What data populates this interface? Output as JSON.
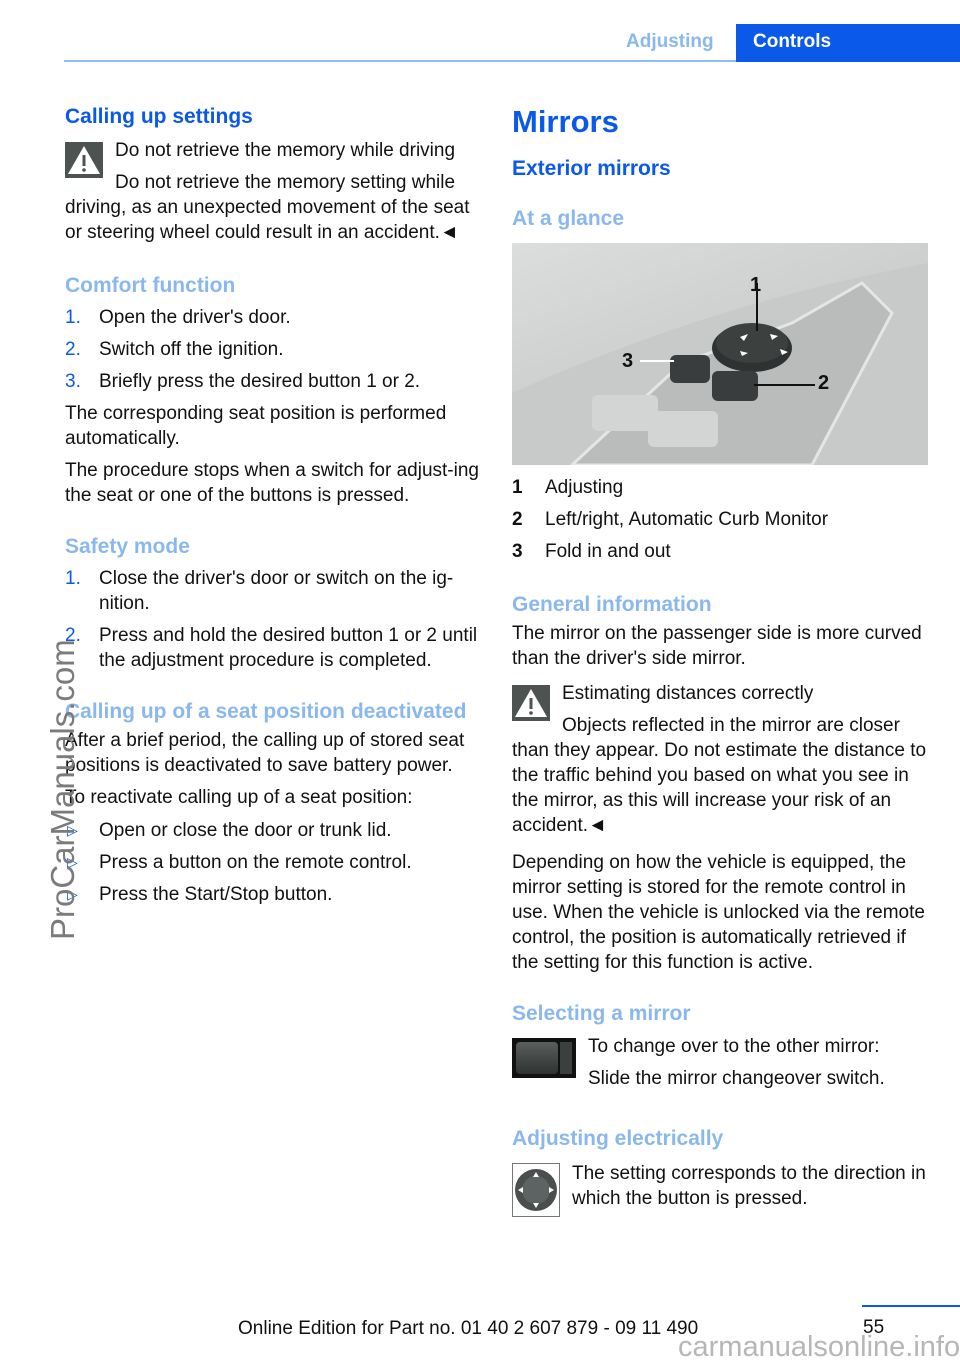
{
  "header": {
    "section": "Adjusting",
    "chapter": "Controls"
  },
  "left": {
    "calling_up_settings": {
      "title": "Calling up settings",
      "warning_title": "Do not retrieve the memory while driving",
      "warning_text": "Do not retrieve the memory setting while driving, as an unexpected movement of the seat or steering wheel could result in an accident.◄"
    },
    "comfort_function": {
      "title": "Comfort function",
      "steps": [
        {
          "num": "1.",
          "text": "Open the driver's door."
        },
        {
          "num": "2.",
          "text": "Switch off the ignition."
        },
        {
          "num": "3.",
          "text": "Briefly press the desired button 1 or 2."
        }
      ],
      "para1": "The corresponding seat position is performed automatically.",
      "para2": "The procedure stops when a switch for adjust-ing the seat or one of the buttons is pressed."
    },
    "safety_mode": {
      "title": "Safety mode",
      "steps": [
        {
          "num": "1.",
          "text": "Close the driver's door or switch on the ig-nition."
        },
        {
          "num": "2.",
          "text": "Press and hold the desired button 1 or 2 until the adjustment procedure is completed."
        }
      ]
    },
    "deactivated": {
      "title": "Calling up of a seat position deactivated",
      "para1": "After a brief period, the calling up of stored seat positions is deactivated to save battery power.",
      "para2": "To reactivate calling up of a seat position:",
      "bullets": [
        {
          "marker": "▷",
          "text": "Open or close the door or trunk lid."
        },
        {
          "marker": "▷",
          "text": "Press a button on the remote control."
        },
        {
          "marker": "▷",
          "text": "Press the Start/Stop button."
        }
      ]
    }
  },
  "right": {
    "title": "Mirrors",
    "subtitle": "Exterior mirrors",
    "at_a_glance": "At a glance",
    "figure_callouts": [
      "1",
      "2",
      "3"
    ],
    "legend": [
      {
        "num": "1",
        "text": "Adjusting"
      },
      {
        "num": "2",
        "text": "Left/right, Automatic Curb Monitor"
      },
      {
        "num": "3",
        "text": "Fold in and out"
      }
    ],
    "general": {
      "title": "General information",
      "para": "The mirror on the passenger side is more curved than the driver's side mirror.",
      "warning_title": "Estimating distances correctly",
      "warning_text": "Objects reflected in the mirror are closer than they appear. Do not estimate the distance to the traffic behind you based on what you see in the mirror, as this will increase your risk of an accident.◄",
      "para2": "Depending on how the vehicle is equipped, the mirror setting is stored for the remote control in use. When the vehicle is unlocked via the remote control, the position is automatically retrieved if the setting for this function is active."
    },
    "selecting": {
      "title": "Selecting a mirror",
      "line1": "To change over to the other mirror:",
      "line2": "Slide the mirror changeover switch."
    },
    "adjusting": {
      "title": "Adjusting electrically",
      "text": "The setting corresponds to the direction in which the button is pressed."
    }
  },
  "footer": {
    "edition": "Online Edition for Part no. 01 40 2 607 879 - 09 11 490",
    "page": "55",
    "watermark_side": "ProCarManuals.com",
    "watermark_bottom": "carmanualsonline.info"
  }
}
